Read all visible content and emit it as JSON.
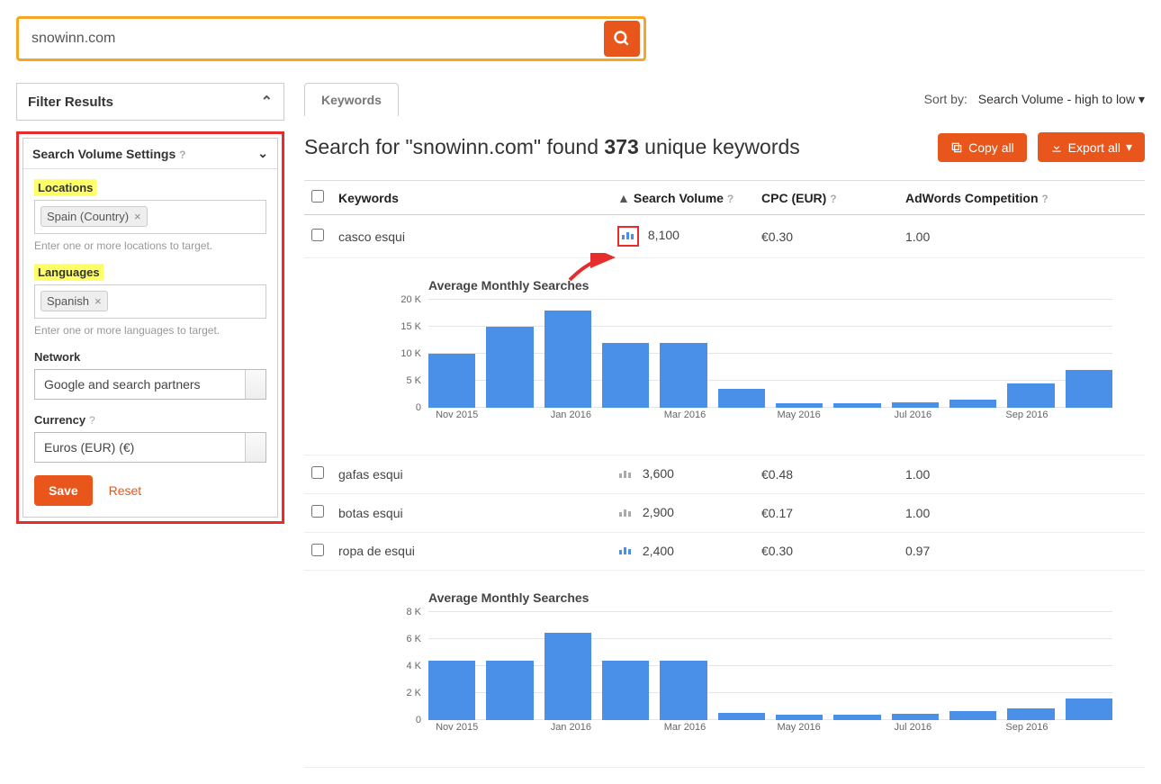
{
  "search": {
    "value": "snowinn.com"
  },
  "sidebar": {
    "filter_results": "Filter Results",
    "svs": {
      "title": "Search Volume Settings",
      "locations_label": "Locations",
      "locations_tag": "Spain (Country)",
      "locations_hint": "Enter one or more locations to target.",
      "languages_label": "Languages",
      "languages_tag": "Spanish",
      "languages_hint": "Enter one or more languages to target.",
      "network_label": "Network",
      "network_value": "Google and search partners",
      "currency_label": "Currency",
      "currency_value": "Euros (EUR) (€)",
      "save": "Save",
      "reset": "Reset"
    }
  },
  "main": {
    "tab": "Keywords",
    "sortby_label": "Sort by:",
    "sortby_value": "Search Volume - high to low",
    "headline_prefix": "Search for \"",
    "headline_term": "snowinn.com",
    "headline_mid": "\" found ",
    "headline_count": "373",
    "headline_suffix": " unique keywords",
    "copy_all": "Copy all",
    "export_all": "Export all",
    "cols": {
      "kw": "Keywords",
      "sv": "Search Volume",
      "cpc": "CPC (EUR)",
      "adc": "AdWords Competition"
    },
    "rows": [
      {
        "kw": "casco esqui",
        "sv": "8,100",
        "cpc": "€0.30",
        "adc": "1.00",
        "boxed": true
      },
      {
        "kw": "gafas esqui",
        "sv": "3,600",
        "cpc": "€0.48",
        "adc": "1.00",
        "boxed": false
      },
      {
        "kw": "botas esqui",
        "sv": "2,900",
        "cpc": "€0.17",
        "adc": "1.00",
        "boxed": false
      },
      {
        "kw": "ropa de esqui",
        "sv": "2,400",
        "cpc": "€0.30",
        "adc": "0.97",
        "boxed": false
      }
    ],
    "charts": [
      {
        "title": "Average Monthly Searches",
        "ymax": 20,
        "yunit": "K",
        "yticks": [
          0,
          5,
          10,
          15,
          20
        ],
        "xticks": [
          "Nov 2015",
          "",
          "Jan 2016",
          "",
          "Mar 2016",
          "",
          "May 2016",
          "",
          "Jul 2016",
          "",
          "Sep 2016",
          ""
        ]
      },
      {
        "title": "Average Monthly Searches",
        "ymax": 8,
        "yunit": "K",
        "yticks": [
          0,
          2,
          4,
          6,
          8
        ],
        "xticks": [
          "Nov 2015",
          "",
          "Jan 2016",
          "",
          "Mar 2016",
          "",
          "May 2016",
          "",
          "Jul 2016",
          "",
          "Sep 2016",
          ""
        ]
      }
    ]
  },
  "chart_data": [
    {
      "type": "bar",
      "title": "Average Monthly Searches",
      "ylabel": "",
      "xlabel": "",
      "ylim": [
        0,
        20000
      ],
      "categories": [
        "Nov 2015",
        "Dec 2015",
        "Jan 2016",
        "Feb 2016",
        "Mar 2016",
        "Apr 2016",
        "May 2016",
        "Jun 2016",
        "Jul 2016",
        "Aug 2016",
        "Sep 2016",
        "Oct 2016"
      ],
      "values": [
        10000,
        15000,
        18000,
        12000,
        12000,
        3500,
        900,
        900,
        1000,
        1500,
        4500,
        7000
      ]
    },
    {
      "type": "bar",
      "title": "Average Monthly Searches",
      "ylabel": "",
      "xlabel": "",
      "ylim": [
        0,
        8000
      ],
      "categories": [
        "Nov 2015",
        "Dec 2015",
        "Jan 2016",
        "Feb 2016",
        "Mar 2016",
        "Apr 2016",
        "May 2016",
        "Jun 2016",
        "Jul 2016",
        "Aug 2016",
        "Sep 2016",
        "Oct 2016"
      ],
      "values": [
        4400,
        4400,
        6500,
        4400,
        4400,
        550,
        400,
        400,
        500,
        700,
        900,
        1600
      ]
    }
  ]
}
